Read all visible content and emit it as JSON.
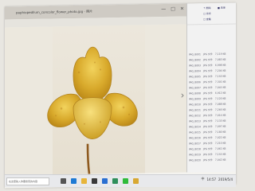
{
  "window": {
    "title": "paphiopedilum_concolor_flower_photo.jpg - 照片",
    "controls": [
      "—",
      "□",
      "✕"
    ]
  },
  "viewer": {
    "next_arrow": "›"
  },
  "explorer": {
    "actions": [
      "↑ 删除",
      "□ 排序",
      "□ 查看",
      "■ 选择"
    ],
    "rows": [
      {
        "name": "IMG_8001",
        "type": "JPG 文件",
        "size": "7,119 KB"
      },
      {
        "name": "IMG_8002",
        "type": "JPG 文件",
        "size": "7,083 KB"
      },
      {
        "name": "IMG_8003",
        "type": "JPG 文件",
        "size": "6,998 KB"
      },
      {
        "name": "IMG_8004",
        "type": "JPG 文件",
        "size": "7,204 KB"
      },
      {
        "name": "IMG_8005",
        "type": "JPG 文件",
        "size": "7,150 KB"
      },
      {
        "name": "IMG_8006",
        "type": "JPG 文件",
        "size": "7,301 KB"
      },
      {
        "name": "IMG_8007",
        "type": "JPG 文件",
        "size": "7,045 KB"
      },
      {
        "name": "IMG_8008",
        "type": "JPG 文件",
        "size": "6,912 KB"
      },
      {
        "name": "IMG_8009",
        "type": "JPG 文件",
        "size": "7,120 KB"
      },
      {
        "name": "IMG_8010",
        "type": "JPG 文件",
        "size": "7,088 KB"
      },
      {
        "name": "IMG_8011",
        "type": "JPG 文件",
        "size": "7,266 KB"
      },
      {
        "name": "IMG_8012",
        "type": "JPG 文件",
        "size": "7,014 KB"
      },
      {
        "name": "IMG_8013",
        "type": "JPG 文件",
        "size": "7,133 KB"
      },
      {
        "name": "IMG_8014",
        "type": "JPG 文件",
        "size": "7,097 KB"
      },
      {
        "name": "IMG_8015",
        "type": "JPG 文件",
        "size": "7,180 KB"
      },
      {
        "name": "IMG_8016",
        "type": "JPG 文件",
        "size": "7,022 KB"
      },
      {
        "name": "IMG_8017",
        "type": "JPG 文件",
        "size": "7,210 KB"
      },
      {
        "name": "IMG_8018",
        "type": "JPG 文件",
        "size": "7,061 KB"
      },
      {
        "name": "IMG_8019",
        "type": "JPG 文件",
        "size": "7,155 KB"
      },
      {
        "name": "IMG_8020",
        "type": "JPG 文件",
        "size": "7,042 KB"
      }
    ]
  },
  "taskbar": {
    "search_placeholder": "在这里输入你要搜索的内容",
    "app_icons": [
      {
        "name": "task-view-icon",
        "color": "#555555"
      },
      {
        "name": "edge-icon",
        "color": "#1e7ad4"
      },
      {
        "name": "explorer-icon",
        "color": "#e7b53a"
      },
      {
        "name": "store-icon",
        "color": "#3a3a3a"
      },
      {
        "name": "mail-icon",
        "color": "#2a6fd1"
      },
      {
        "name": "photos-icon",
        "color": "#2f8f5b"
      },
      {
        "name": "wechat-icon",
        "color": "#2fbb3b"
      },
      {
        "name": "folder-icon",
        "color": "#d8a832"
      }
    ],
    "tray": {
      "clock": "14:57",
      "date": "2019/5/4",
      "input_method": "中"
    }
  }
}
